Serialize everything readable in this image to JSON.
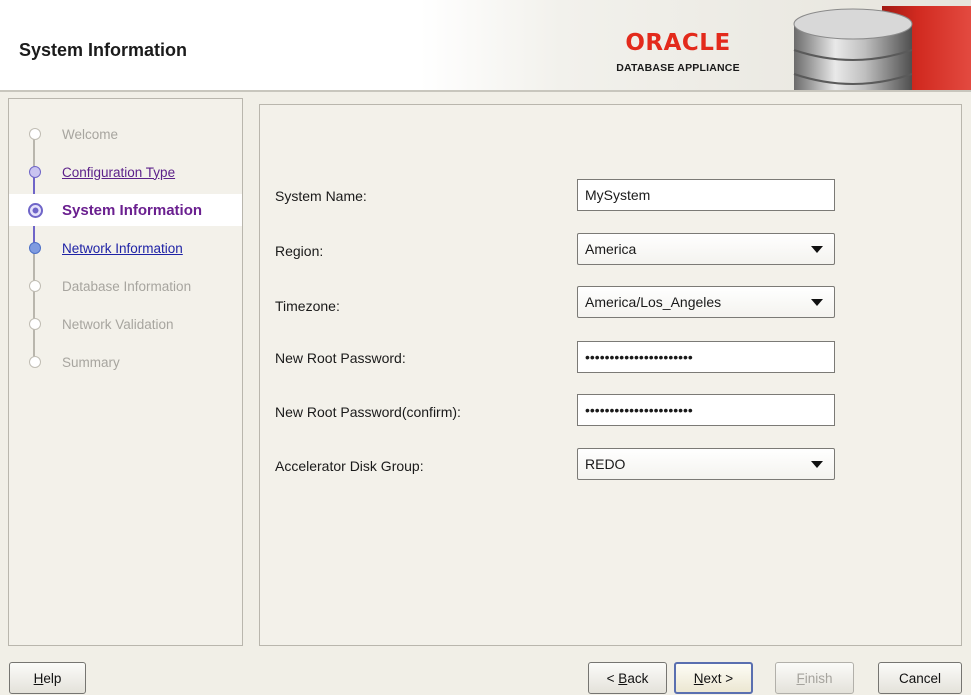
{
  "header": {
    "title": "System Information",
    "brand_name": "ORACLE",
    "brand_sub": "DATABASE APPLIANCE",
    "brand_color": "#e32a1c"
  },
  "steps": [
    {
      "label": "Welcome",
      "state": "disabled"
    },
    {
      "label": "Configuration Type",
      "state": "visited"
    },
    {
      "label": "System Information",
      "state": "current"
    },
    {
      "label": "Network Information",
      "state": "link"
    },
    {
      "label": "Database Information",
      "state": "disabled"
    },
    {
      "label": "Network Validation",
      "state": "disabled"
    },
    {
      "label": "Summary",
      "state": "disabled"
    }
  ],
  "form": {
    "system_name": {
      "label": "System Name:",
      "value": "MySystem"
    },
    "region": {
      "label": "Region:",
      "value": "America"
    },
    "timezone": {
      "label": "Timezone:",
      "value": "America/Los_Angeles"
    },
    "root_password": {
      "label": "New Root Password:",
      "value": "••••••••••••••••••••••"
    },
    "root_password_confirm": {
      "label": "New Root Password(confirm):",
      "value": "••••••••••••••••••••••"
    },
    "accelerator_disk_group": {
      "label": "Accelerator Disk Group:",
      "value": "REDO"
    }
  },
  "buttons": {
    "help": {
      "mn": "H",
      "rest": "elp"
    },
    "back": {
      "pre": "< ",
      "mn": "B",
      "rest": "ack"
    },
    "next": {
      "mn": "N",
      "rest": "ext >"
    },
    "finish": {
      "mn": "F",
      "rest": "inish"
    },
    "cancel": "Cancel"
  }
}
